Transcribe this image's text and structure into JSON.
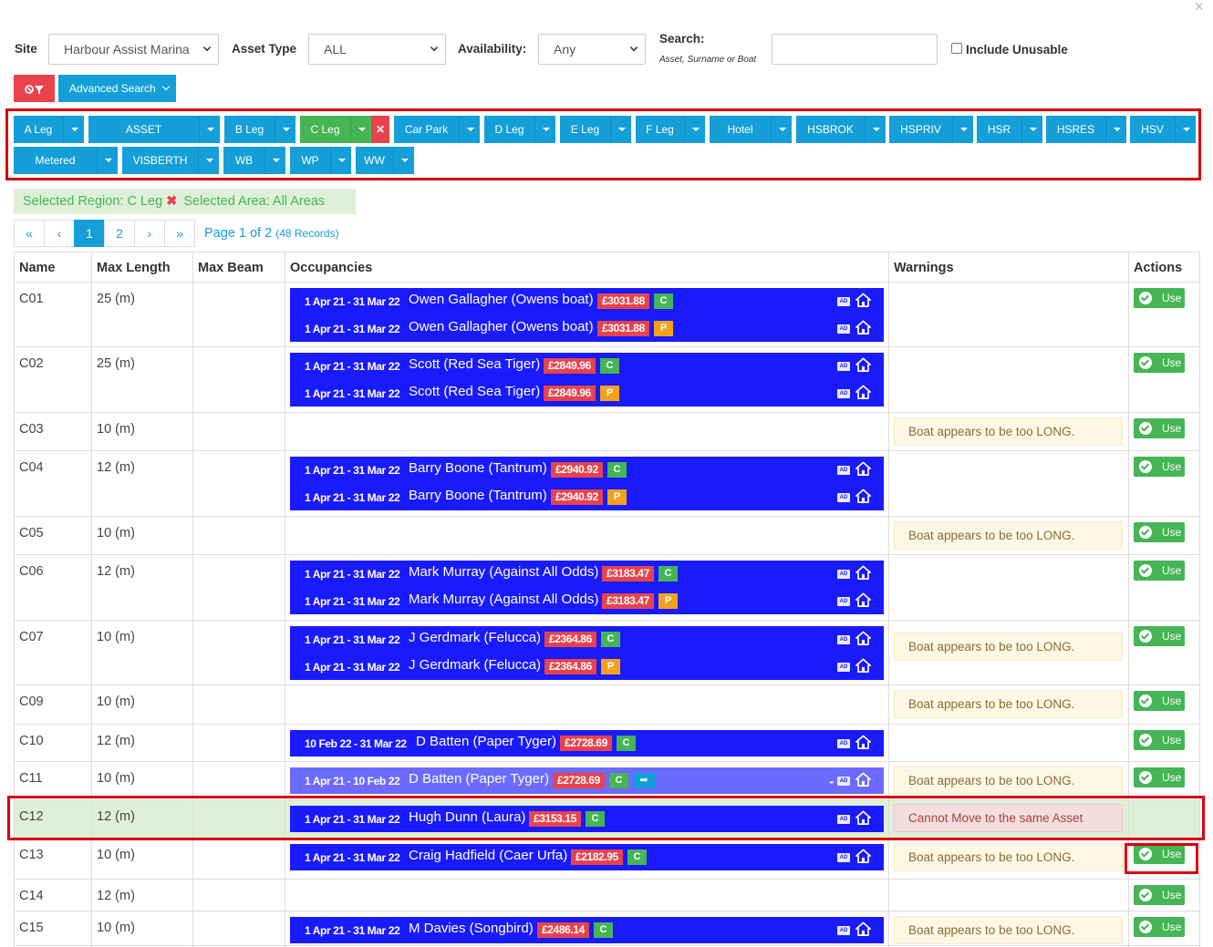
{
  "window": {
    "close_glyph": "×"
  },
  "filters": {
    "site_label": "Site",
    "site_value": "Harbour Assist Marina",
    "asset_type_label": "Asset Type",
    "asset_type_value": "ALL",
    "availability_label": "Availability:",
    "availability_value": "Any",
    "search_label": "Search:",
    "search_sub": "Asset, Surname or Boat",
    "search_value": "",
    "include_unusable_label": "Include Unusable",
    "include_unusable_checked": false
  },
  "toolbar": {
    "clear_icon": "filter-off-icon",
    "advanced_search_label": "Advanced Search"
  },
  "regions": [
    {
      "label": "A Leg"
    },
    {
      "label": "ASSET INSPECTIONS"
    },
    {
      "label": "B Leg"
    },
    {
      "label": "C Leg",
      "selected": true
    },
    {
      "label": "Car Park"
    },
    {
      "label": "D Leg"
    },
    {
      "label": "E Leg"
    },
    {
      "label": "F Leg"
    },
    {
      "label": "Hotel Rooms"
    },
    {
      "label": "HSBROK"
    },
    {
      "label": "HSPRIV"
    },
    {
      "label": "HSR"
    },
    {
      "label": "HSRES"
    },
    {
      "label": "HSV"
    },
    {
      "label": "Metered Services"
    },
    {
      "label": "VISBERTH"
    },
    {
      "label": "WB"
    },
    {
      "label": "WP"
    },
    {
      "label": "WW"
    }
  ],
  "selection": {
    "region_text": "Selected Region: C Leg",
    "area_text": "Selected Area: All Areas"
  },
  "pagination": {
    "first": "«",
    "prev": "‹",
    "pages": [
      "1",
      "2"
    ],
    "current": "1",
    "next": "›",
    "last": "»",
    "info": "Page 1 of 2",
    "records": "(48 Records)"
  },
  "table": {
    "headers": {
      "name": "Name",
      "max_length": "Max Length",
      "max_beam": "Max Beam",
      "occupancies": "Occupancies",
      "warnings": "Warnings",
      "actions": "Actions"
    },
    "use_label": "Use",
    "rows": [
      {
        "name": "C01",
        "max_length": "25 (m)",
        "max_beam": "",
        "occupancies": [
          {
            "dates": "1 Apr 21 - 31 Mar 22",
            "who": "Owen Gallagher (Owens boat)",
            "price": "£3031.88",
            "tag": "C"
          },
          {
            "dates": "1 Apr 21 - 31 Mar 22",
            "who": "Owen Gallagher (Owens boat)",
            "price": "£3031.88",
            "tag": "P"
          }
        ],
        "warning": ""
      },
      {
        "name": "C02",
        "max_length": "25 (m)",
        "max_beam": "",
        "occupancies": [
          {
            "dates": "1 Apr 21 - 31 Mar 22",
            "who": "Scott (Red Sea Tiger)",
            "price": "£2849.96",
            "tag": "C"
          },
          {
            "dates": "1 Apr 21 - 31 Mar 22",
            "who": "Scott (Red Sea Tiger)",
            "price": "£2849.96",
            "tag": "P"
          }
        ],
        "warning": ""
      },
      {
        "name": "C03",
        "max_length": "10 (m)",
        "max_beam": "",
        "occupancies": [],
        "warning": "Boat appears to be too LONG."
      },
      {
        "name": "C04",
        "max_length": "12 (m)",
        "max_beam": "",
        "occupancies": [
          {
            "dates": "1 Apr 21 - 31 Mar 22",
            "who": "Barry Boone (Tantrum)",
            "price": "£2940.92",
            "tag": "C"
          },
          {
            "dates": "1 Apr 21 - 31 Mar 22",
            "who": "Barry Boone (Tantrum)",
            "price": "£2940.92",
            "tag": "P"
          }
        ],
        "warning": ""
      },
      {
        "name": "C05",
        "max_length": "10 (m)",
        "max_beam": "",
        "occupancies": [],
        "warning": "Boat appears to be too LONG."
      },
      {
        "name": "C06",
        "max_length": "12 (m)",
        "max_beam": "",
        "occupancies": [
          {
            "dates": "1 Apr 21 - 31 Mar 22",
            "who": "Mark Murray (Against All Odds)",
            "price": "£3183.47",
            "tag": "C"
          },
          {
            "dates": "1 Apr 21 - 31 Mar 22",
            "who": "Mark Murray (Against All Odds)",
            "price": "£3183.47",
            "tag": "P"
          }
        ],
        "warning": ""
      },
      {
        "name": "C07",
        "max_length": "10 (m)",
        "max_beam": "",
        "occupancies": [
          {
            "dates": "1 Apr 21 - 31 Mar 22",
            "who": "J Gerdmark (Felucca)",
            "price": "£2364.86",
            "tag": "C"
          },
          {
            "dates": "1 Apr 21 - 31 Mar 22",
            "who": "J Gerdmark (Felucca)",
            "price": "£2364.86",
            "tag": "P"
          }
        ],
        "warning": "Boat appears to be too LONG."
      },
      {
        "name": "C09",
        "max_length": "10 (m)",
        "max_beam": "",
        "occupancies": [],
        "warning": "Boat appears to be too LONG."
      },
      {
        "name": "C10",
        "max_length": "12 (m)",
        "max_beam": "",
        "occupancies": [
          {
            "dates": "10 Feb 22 - 31 Mar 22",
            "who": "D Batten (Paper Tyger)",
            "price": "£2728.69",
            "tag": "C"
          }
        ],
        "warning": ""
      },
      {
        "name": "C11",
        "max_length": "10 (m)",
        "max_beam": "",
        "occupancies": [
          {
            "dates": "1 Apr 21 - 10 Feb 22",
            "who": "D Batten (Paper Tyger)",
            "price": "£2728.69",
            "tag": "C",
            "moved": true
          }
        ],
        "warning": "Boat appears to be too LONG."
      },
      {
        "name": "C12",
        "max_length": "12 (m)",
        "max_beam": "",
        "occupancies": [
          {
            "dates": "1 Apr 21 - 31 Mar 22",
            "who": "Hugh Dunn (Laura)",
            "price": "£3153.15",
            "tag": "C"
          }
        ],
        "warning": "Cannot Move to the same Asset",
        "is_current": true
      },
      {
        "name": "C13",
        "max_length": "10 (m)",
        "max_beam": "",
        "occupancies": [
          {
            "dates": "1 Apr 21 - 31 Mar 22",
            "who": "Craig Hadfield (Caer Urfa)",
            "price": "£2182.95",
            "tag": "C"
          }
        ],
        "warning": "Boat appears to be too LONG."
      },
      {
        "name": "C14",
        "max_length": "12 (m)",
        "max_beam": "",
        "occupancies": [],
        "warning": ""
      },
      {
        "name": "C15",
        "max_length": "10 (m)",
        "max_beam": "",
        "occupancies": [
          {
            "dates": "1 Apr 21 - 31 Mar 22",
            "who": "M Davies (Songbird)",
            "price": "£2486.14",
            "tag": "C"
          }
        ],
        "warning": "Boat appears to be too LONG."
      }
    ]
  },
  "icons": {
    "ad": "AD",
    "home": "home-icon",
    "arrow": "➡",
    "dots": "••"
  },
  "colors": {
    "primary": "#149fd9",
    "success": "#45b555",
    "danger": "#e8434c",
    "warning": "#f4a11c",
    "occupancy": "#1a1aff",
    "occupancy_moved": "#6b6bff",
    "highlight": "#d9000d"
  }
}
